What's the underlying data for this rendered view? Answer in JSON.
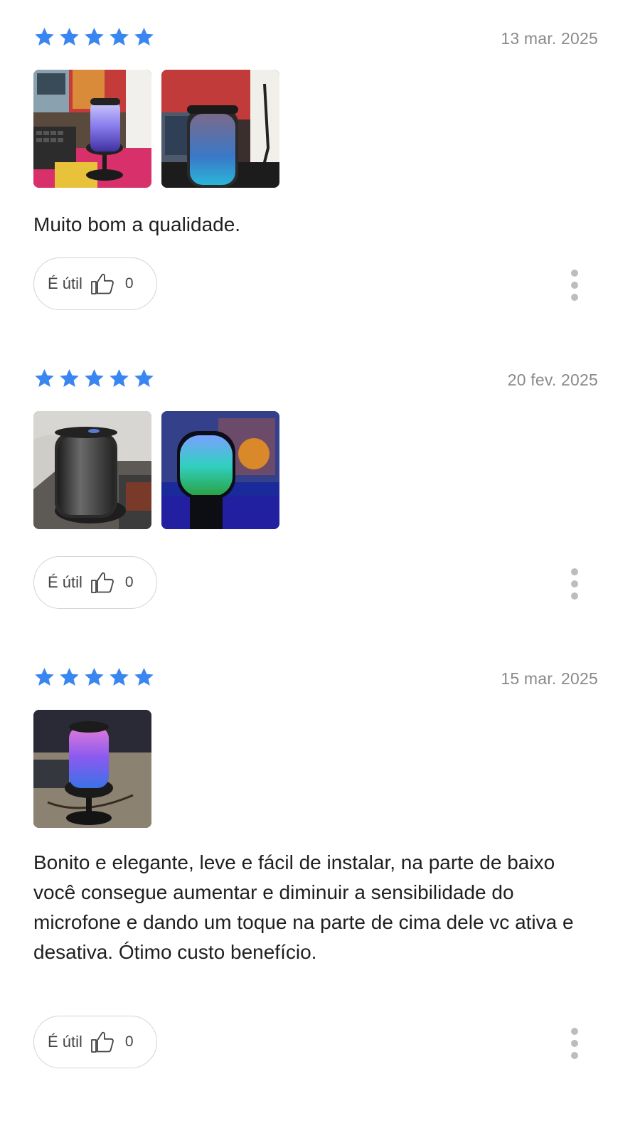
{
  "colors": {
    "star": "#3a86f0",
    "date": "#8a8a8a",
    "pill_border": "#d4d4d4",
    "more_dots": "#bdbdbd"
  },
  "reviews": [
    {
      "rating": 5,
      "date": "13 mar. 2025",
      "photos": [
        "review-photo-microphone-desk",
        "review-photo-microphone-rgb"
      ],
      "text": "Muito bom a qualidade.",
      "useful_label": "É útil",
      "useful_count": "0",
      "more_icon": "more-vertical-icon"
    },
    {
      "rating": 5,
      "date": "20 fev. 2025",
      "photos": [
        "review-photo-microphone-unboxed",
        "review-photo-microphone-blue-light"
      ],
      "text": "",
      "useful_label": "É útil",
      "useful_count": "0",
      "more_icon": "more-vertical-icon"
    },
    {
      "rating": 5,
      "date": "15 mar. 2025",
      "photos": [
        "review-photo-microphone-purple-light"
      ],
      "text": "Bonito e elegante, leve e fácil de instalar, na parte de baixo você consegue aumentar e diminuir a sensibilidade do microfone e dando um toque na parte de cima dele vc ativa e desativa. Ótimo custo benefício.",
      "useful_label": "É útil",
      "useful_count": "0",
      "more_icon": "more-vertical-icon"
    }
  ]
}
